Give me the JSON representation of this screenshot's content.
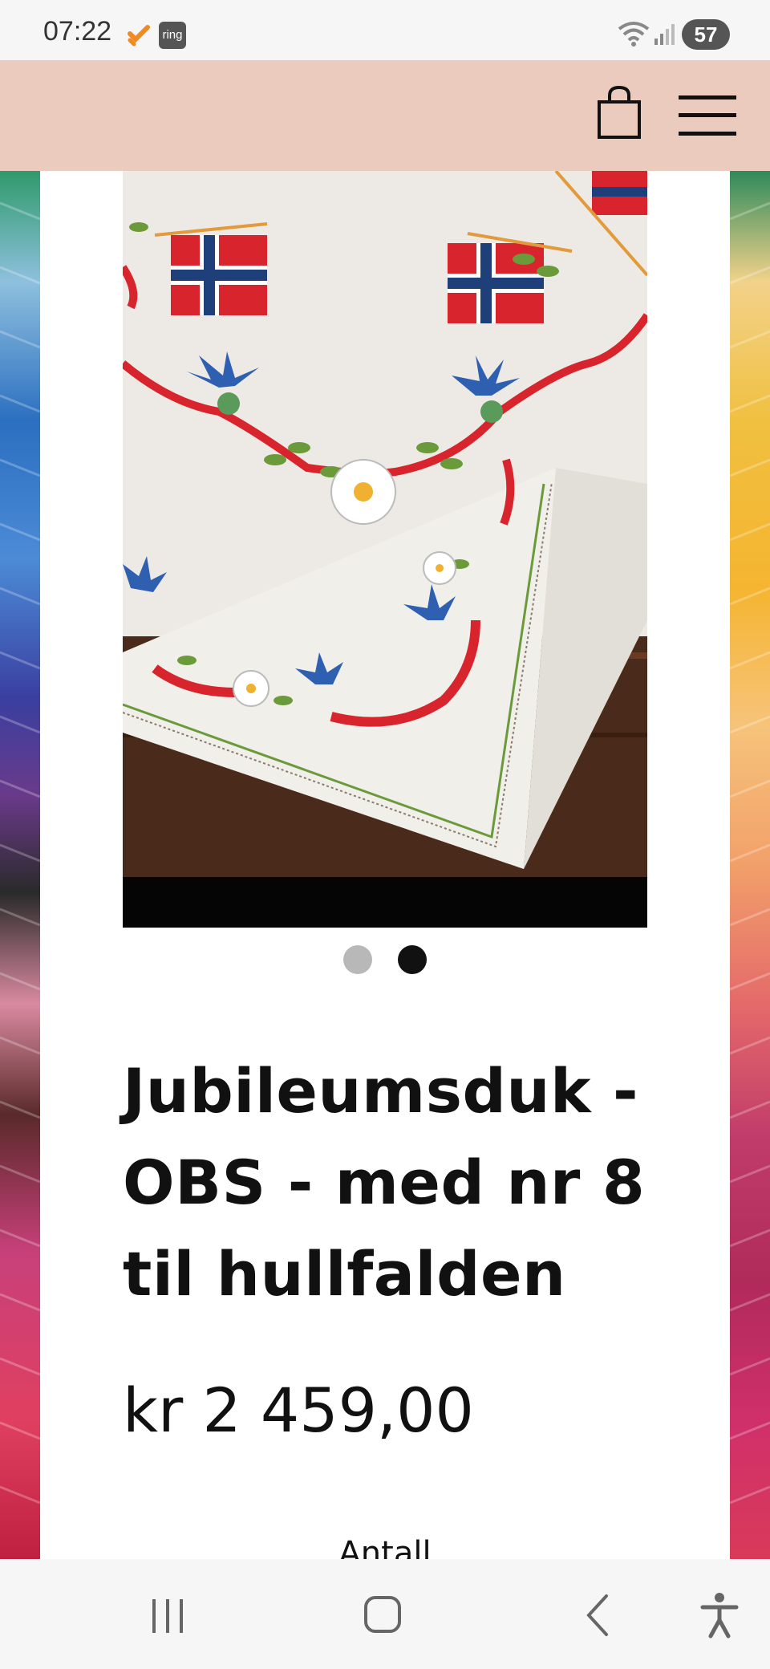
{
  "status_bar": {
    "time": "07:22",
    "ring_app_label": "ring",
    "battery_level": "57",
    "wifi_badge": "5"
  },
  "header": {
    "background_color": "#eacbbe",
    "cart_icon": "shopping-bag-icon",
    "menu_icon": "hamburger-menu-icon"
  },
  "gallery": {
    "image_count": 2,
    "active_index": 2,
    "image_description_icon": "product-image-embroidered-tablecloth"
  },
  "product": {
    "title": "Jubileumsduk - OBS - med nr 8 til hullfalden",
    "price": "kr 2 459,00",
    "quantity_label": "Antall"
  },
  "nav_bar": {
    "recents_icon": "recents-icon",
    "home_icon": "home-icon",
    "back_icon": "back-icon",
    "accessibility_icon": "accessibility-icon"
  },
  "colors": {
    "header_bg": "#eacbbe",
    "flag_red": "#d8242c",
    "flag_blue": "#1f3f7a",
    "thistle_blue": "#2f5fb0"
  }
}
